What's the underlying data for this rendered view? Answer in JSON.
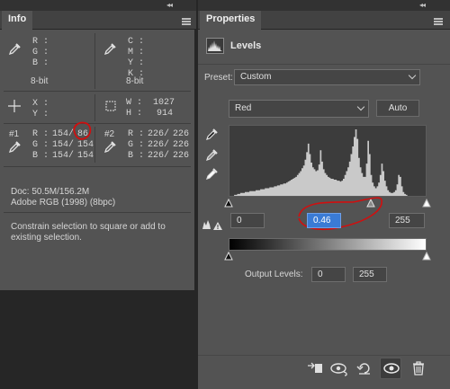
{
  "info_panel": {
    "tab_label": "Info",
    "color1": {
      "labels": "R :\nG :\nB :",
      "mode": "8-bit"
    },
    "color2": {
      "labels": "C :\nM :\nY :\nK :",
      "mode": "8-bit"
    },
    "position": {
      "labels": "X :\nY :"
    },
    "size": {
      "labels": "W :\nH :",
      "values": "1027\n914"
    },
    "sampler1": {
      "id": "#1",
      "labels": "R :\nG :\nB :",
      "before": "154/\n154/\n154/",
      "after": "86\n154\n154"
    },
    "sampler2": {
      "id": "#2",
      "labels": "R :\nG :\nB :",
      "before": "226/\n226/\n226/",
      "after": "226\n226\n226"
    },
    "doc_size": "Doc: 50.5M/156.2M",
    "profile": "Adobe RGB (1998) (8bpc)",
    "hint": "Constrain selection to square or add to existing selection."
  },
  "properties_panel": {
    "tab_label": "Properties",
    "adjustment_title": "Levels",
    "preset_label": "Preset:",
    "preset_value": "Custom",
    "channel": "Red",
    "auto_label": "Auto",
    "input_black": "0",
    "input_gamma": "0.46",
    "input_white": "255",
    "output_label": "Output Levels:",
    "output_black": "0",
    "output_white": "255",
    "histogram": [
      0,
      0,
      0,
      1,
      1,
      2,
      2,
      3,
      3,
      3,
      4,
      4,
      4,
      5,
      5,
      5,
      5,
      6,
      6,
      6,
      7,
      7,
      7,
      8,
      8,
      8,
      9,
      9,
      9,
      10,
      10,
      11,
      11,
      12,
      12,
      13,
      13,
      14,
      15,
      16,
      17,
      18,
      19,
      20,
      22,
      24,
      26,
      29,
      32,
      38,
      46,
      55,
      44,
      35,
      30,
      28,
      26,
      27,
      33,
      48,
      36,
      28,
      24,
      22,
      20,
      19,
      18,
      18,
      17,
      17,
      16,
      16,
      15,
      16,
      18,
      22,
      26,
      30,
      36,
      44,
      52,
      62,
      70,
      60,
      40,
      30,
      24,
      20,
      20,
      34,
      58,
      44,
      22,
      14,
      10,
      8,
      10,
      14,
      22,
      34,
      26,
      16,
      10,
      6,
      4,
      3,
      3,
      4,
      6,
      12,
      22,
      20,
      10,
      4,
      2,
      1,
      0,
      0,
      0,
      0,
      0,
      0,
      0,
      0,
      0,
      0,
      0,
      0
    ],
    "colors": {
      "highlight_field": "#3a7bd5",
      "annotation": "#d10f0f"
    }
  }
}
